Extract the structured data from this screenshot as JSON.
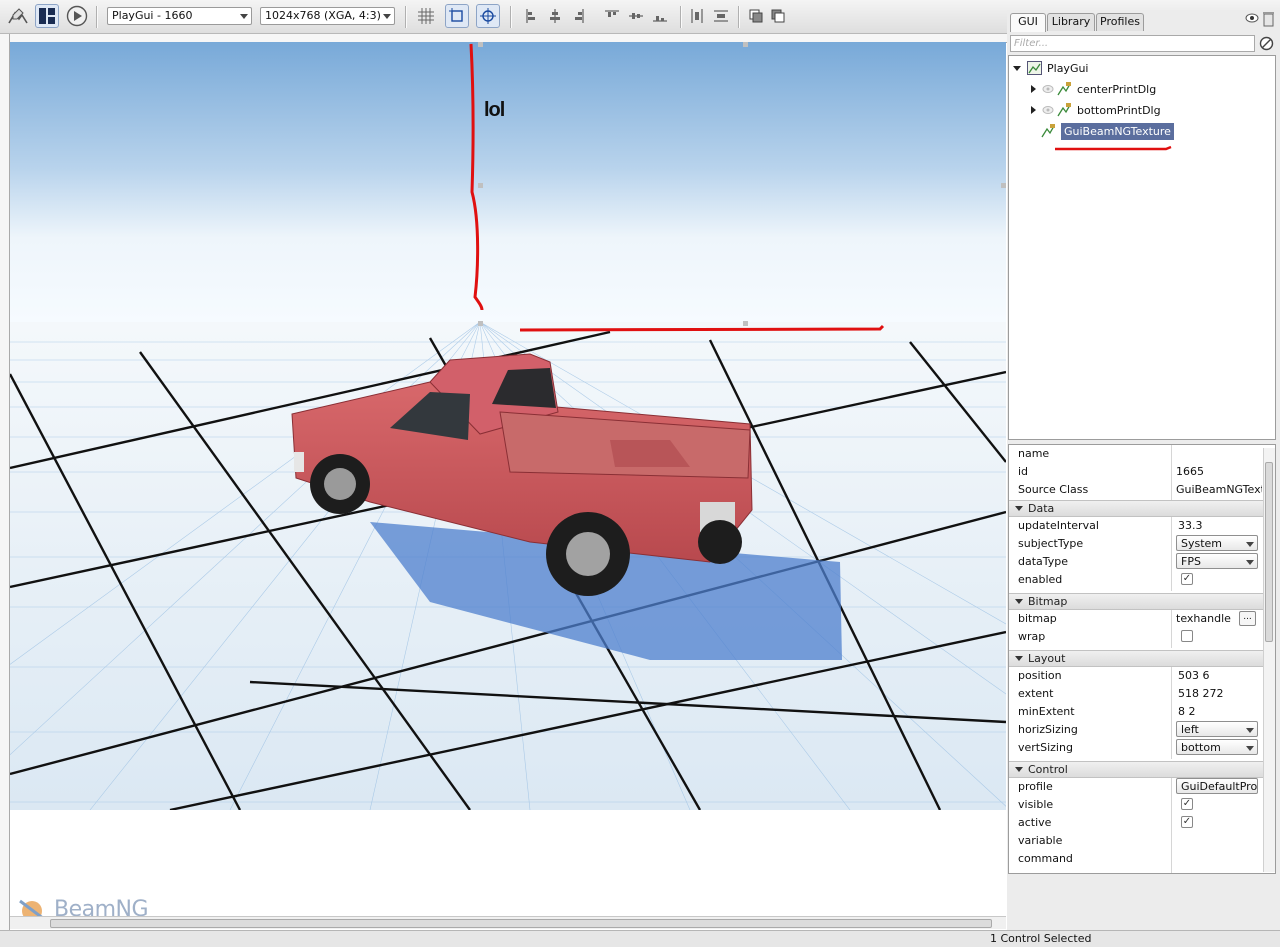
{
  "toolbar": {
    "canvas_select": "PlayGui - 1660",
    "resolution_select": "1024x768 (XGA, 4:3)"
  },
  "canvas": {
    "overlay_text": "lol"
  },
  "branding": {
    "logo_text": "BeamNG"
  },
  "panel": {
    "tabs": [
      "GUI",
      "Library",
      "Profiles"
    ],
    "filter_placeholder": "Filter..."
  },
  "tree": {
    "root": "PlayGui",
    "children": [
      "centerPrintDlg",
      "bottomPrintDlg",
      "GuiBeamNGTexture"
    ]
  },
  "inspector": {
    "top_fields": [
      {
        "name": "name",
        "value": ""
      },
      {
        "name": "id",
        "value": "1665"
      },
      {
        "name": "Source Class",
        "value": "GuiBeamNGTextu"
      }
    ],
    "groups": {
      "data": "Data",
      "bitmap": "Bitmap",
      "layout": "Layout",
      "control": "Control"
    },
    "data_fields": {
      "updateInterval": {
        "name": "updateInterval",
        "value": "33.3"
      },
      "subjectType": {
        "name": "subjectType",
        "value": "System"
      },
      "dataType": {
        "name": "dataType",
        "value": "FPS"
      },
      "enabled": {
        "name": "enabled",
        "checked": true
      }
    },
    "bitmap_fields": {
      "bitmap": {
        "name": "bitmap",
        "value": "texhandle",
        "button": "..."
      },
      "wrap": {
        "name": "wrap",
        "checked": false
      }
    },
    "layout_fields": {
      "position": {
        "name": "position",
        "value": "503 6"
      },
      "extent": {
        "name": "extent",
        "value": "518 272"
      },
      "minExtent": {
        "name": "minExtent",
        "value": "8 2"
      },
      "horizSizing": {
        "name": "horizSizing",
        "value": "left"
      },
      "vertSizing": {
        "name": "vertSizing",
        "value": "bottom"
      }
    },
    "control_fields": {
      "profile": {
        "name": "profile",
        "value": "GuiDefaultProfile"
      },
      "visible": {
        "name": "visible",
        "checked": true
      },
      "active": {
        "name": "active",
        "checked": true
      },
      "variable": {
        "name": "variable",
        "value": ""
      },
      "command": {
        "name": "command",
        "value": ""
      }
    }
  },
  "status": {
    "text": "1 Control Selected"
  },
  "colors": {
    "selection": "#5b6e9e",
    "annotation_red": "#e01010",
    "truck": "#c9555a"
  }
}
